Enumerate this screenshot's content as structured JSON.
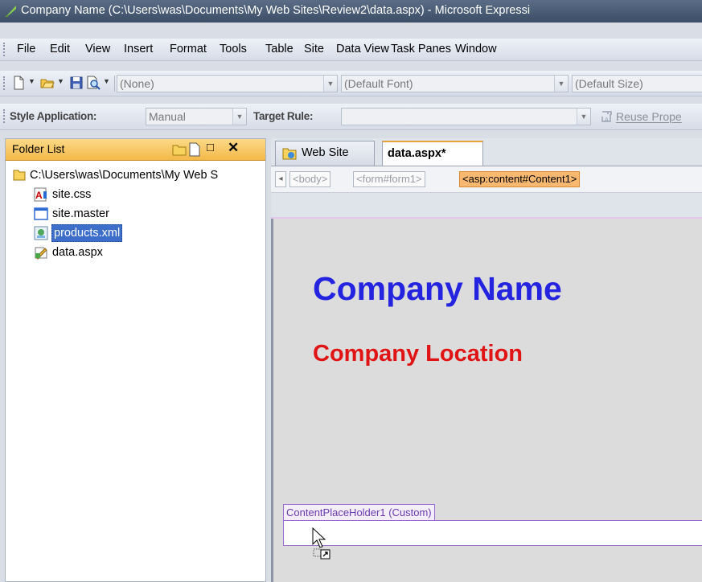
{
  "window": {
    "title": "Company Name (C:\\Users\\was\\Documents\\My Web Sites\\Review2\\data.aspx) - Microsoft Expressi"
  },
  "menu": {
    "items": [
      "File",
      "Edit",
      "View",
      "Insert",
      "Format",
      "Tools",
      "Table",
      "Site",
      "Data View",
      "Task Panes",
      "Window"
    ]
  },
  "toolbar": {
    "style_combo": "(None)",
    "font_combo": "(Default Font)",
    "size_combo": "(Default Size)"
  },
  "style_toolbar": {
    "style_application_label": "Style Application:",
    "style_application_value": "Manual",
    "target_rule_label": "Target Rule:",
    "target_rule_value": "",
    "reuse_label": "Reuse Prope"
  },
  "folder_list": {
    "title": "Folder List",
    "root": "C:\\Users\\was\\Documents\\My Web S",
    "files": [
      {
        "name": "site.css",
        "icon": "css-file-icon"
      },
      {
        "name": "site.master",
        "icon": "master-page-icon"
      },
      {
        "name": "products.xml",
        "icon": "xml-file-icon",
        "selected": true
      },
      {
        "name": "data.aspx",
        "icon": "aspx-file-icon"
      }
    ]
  },
  "editor": {
    "tabs": [
      "Web Site",
      "data.aspx*"
    ],
    "active_tab": "data.aspx*",
    "quick_tags": [
      "<body>",
      "<form#form1>",
      "<asp:content#Content1>"
    ],
    "heading": "Company Name",
    "subheading": "Company Location",
    "placeholder_label": "ContentPlaceHolder1 (Custom)"
  },
  "colors": {
    "heading": "#2424e0",
    "subheading": "#e01414",
    "selection": "#3d6ec9",
    "active_quicktag": "#f8b870",
    "placeholder_border": "#9a6ad0"
  }
}
